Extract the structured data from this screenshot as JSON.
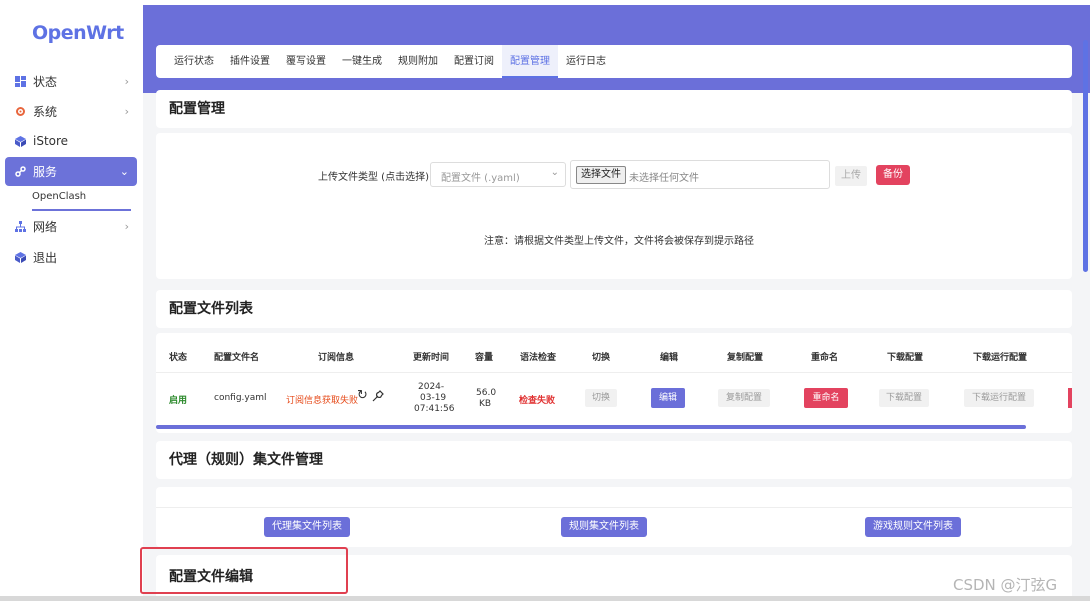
{
  "brand": "OpenWrt",
  "sidebar": {
    "items": [
      {
        "label": "状态",
        "icon": "dashboard-icon",
        "chevron": "›"
      },
      {
        "label": "系统",
        "icon": "gear-icon",
        "chevron": "›"
      },
      {
        "label": "iStore",
        "icon": "cube-icon",
        "chevron": ""
      },
      {
        "label": "服务",
        "icon": "link-icon",
        "chevron": "⌄"
      },
      {
        "label": "网络",
        "icon": "network-icon",
        "chevron": "›"
      },
      {
        "label": "退出",
        "icon": "cube-icon",
        "chevron": ""
      }
    ],
    "sub_item": "OpenClash"
  },
  "tabs": [
    "运行状态",
    "插件设置",
    "覆写设置",
    "一键生成",
    "规则附加",
    "配置订阅",
    "配置管理",
    "运行日志"
  ],
  "active_tab": "配置管理",
  "config_mgmt": {
    "title": "配置管理",
    "upload_label": "上传文件类型 (点击选择)",
    "select_value": "配置文件 (.yaml)",
    "file_button": "选择文件",
    "file_status": "未选择任何文件",
    "upload_button": "上传",
    "backup_button": "备份",
    "notice": "注意：请根据文件类型上传文件，文件将会被保存到提示路径"
  },
  "config_list": {
    "title": "配置文件列表",
    "headers": [
      "状态",
      "配置文件名",
      "订阅信息",
      "更新时间",
      "容量",
      "语法检查",
      "切换",
      "编辑",
      "复制配置",
      "重命名",
      "下载配置",
      "下载运行配置"
    ],
    "row": {
      "status": "启用",
      "filename": "config.yaml",
      "subscription": "订阅信息获取失败",
      "updated_date": "2024-",
      "updated_date2": "03-19",
      "updated_time": "07:41:56",
      "size1": "56.0",
      "size2": "KB",
      "syntax": "检查失败",
      "switch": "切换",
      "edit": "编辑",
      "copy": "复制配置",
      "rename": "重命名",
      "download": "下载配置",
      "download_running": "下载运行配置"
    }
  },
  "proxy_mgmt": {
    "title": "代理（规则）集文件管理",
    "buttons": [
      "代理集文件列表",
      "规则集文件列表",
      "游戏规则文件列表"
    ]
  },
  "editor": {
    "title": "配置文件编辑"
  },
  "watermark": "CSDN @汀弦G",
  "colors": {
    "accent": "#6b6fd9",
    "danger": "#e3435f",
    "fail_text": "#e64a19",
    "enabled_text": "#2e8b2e"
  }
}
